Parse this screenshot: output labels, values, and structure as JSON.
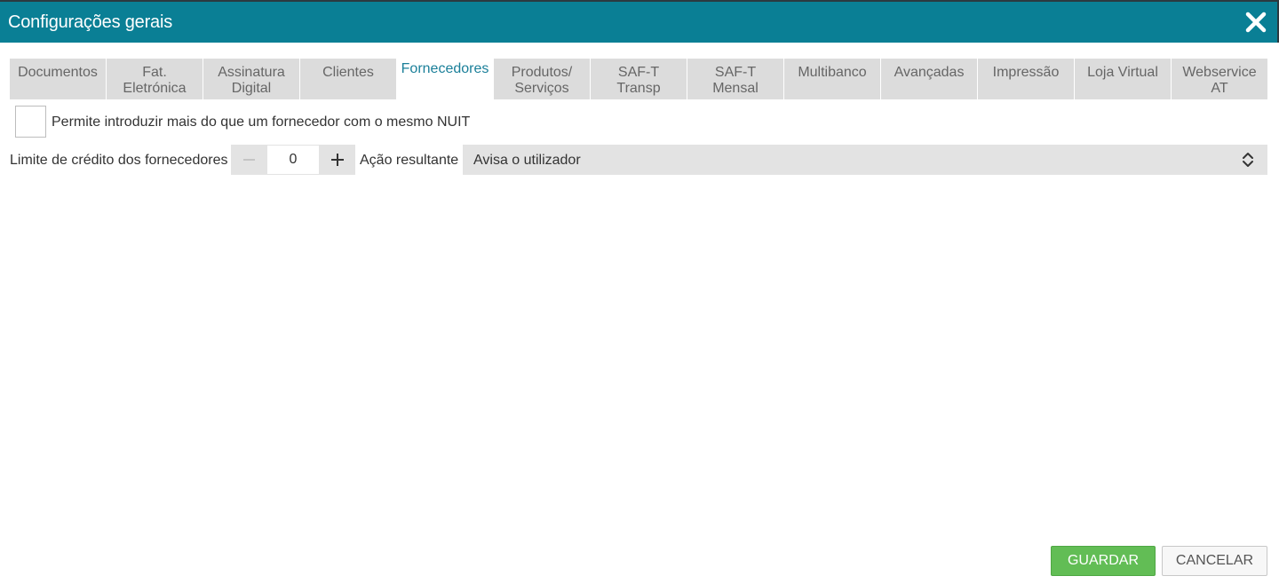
{
  "window": {
    "title": "Configurações gerais"
  },
  "tabs": [
    {
      "line1": "Documentos",
      "line2": ""
    },
    {
      "line1": "Fat.",
      "line2": "Eletrónica"
    },
    {
      "line1": "Assinatura",
      "line2": "Digital"
    },
    {
      "line1": "Clientes",
      "line2": ""
    },
    {
      "line1": "Fornecedores",
      "line2": ""
    },
    {
      "line1": "Produtos/",
      "line2": "Serviços"
    },
    {
      "line1": "SAF-T",
      "line2": "Transp"
    },
    {
      "line1": "SAF-T",
      "line2": "Mensal"
    },
    {
      "line1": "Multibanco",
      "line2": ""
    },
    {
      "line1": "Avançadas",
      "line2": ""
    },
    {
      "line1": "Impressão",
      "line2": ""
    },
    {
      "line1": "Loja Virtual",
      "line2": ""
    },
    {
      "line1": "Webservice",
      "line2": "AT"
    }
  ],
  "active_tab": "Fornecedores",
  "form": {
    "allow_duplicate_nuit_label": "Permite introduzir mais do que um fornecedor com o mesmo NUIT",
    "allow_duplicate_nuit_checked": false,
    "credit_limit_label": "Limite de crédito dos fornecedores",
    "credit_limit_value": "0",
    "action_label": "Ação resultante",
    "action_value": "Avisa o utilizador"
  },
  "buttons": {
    "save": "GUARDAR",
    "cancel": "CANCELAR"
  },
  "colors": {
    "titlebar": "#0a7f95",
    "active_tab_text": "#1a7f99",
    "tab_bg": "#dcdcdc",
    "save_button": "#62bd55"
  },
  "icons": {
    "close": "close-icon",
    "select_arrow": "up-down-chevron-icon",
    "minus": "minus-icon",
    "plus": "plus-icon"
  }
}
